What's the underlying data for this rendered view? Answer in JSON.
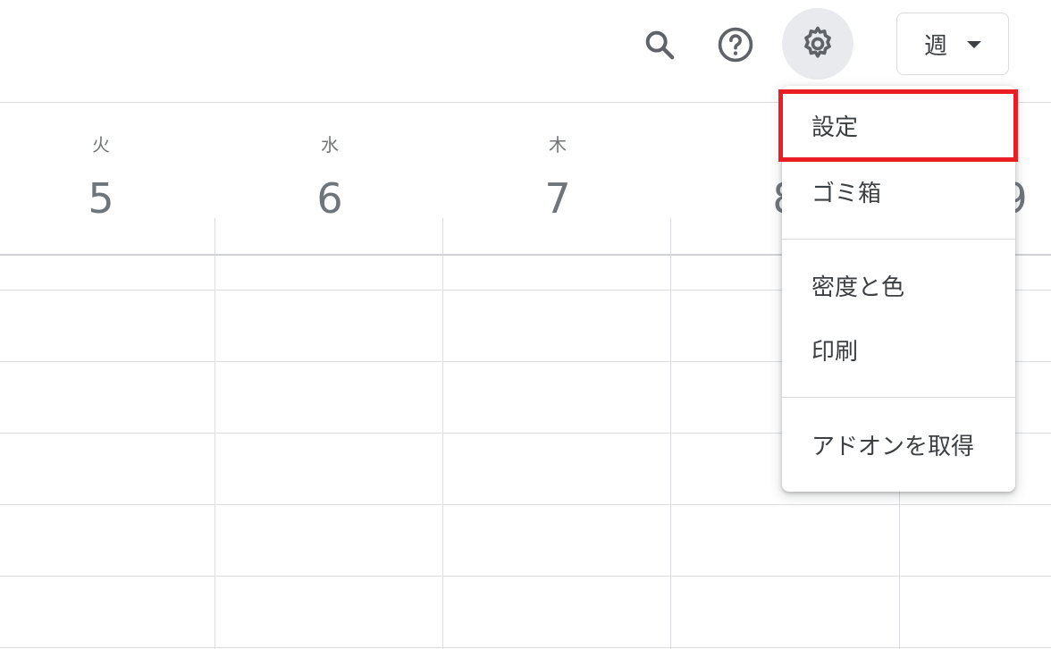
{
  "header": {
    "view_label": "週",
    "icons": [
      "search-icon",
      "help-icon",
      "gear-icon",
      "chevron-down-icon"
    ]
  },
  "days": [
    {
      "dow": "火",
      "num": "5"
    },
    {
      "dow": "水",
      "num": "6"
    },
    {
      "dow": "木",
      "num": "7"
    },
    {
      "dow": "",
      "num": "8"
    },
    {
      "dow": "",
      "num": "9"
    }
  ],
  "settings_menu": {
    "items": [
      "設定",
      "ゴミ箱",
      "密度と色",
      "印刷",
      "アドオンを取得"
    ]
  },
  "colors": {
    "highlight": "#ea1c24",
    "gridline": "#dadce0",
    "active_button_bg": "#e8eaed"
  }
}
